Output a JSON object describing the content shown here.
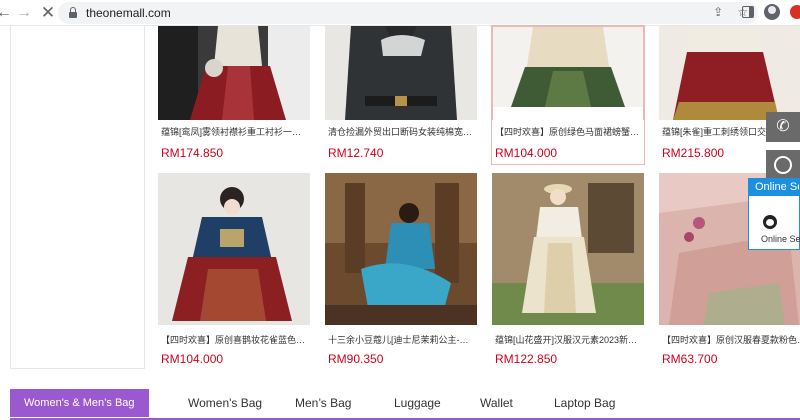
{
  "browser": {
    "url": "theonemall.com"
  },
  "products": [
    {
      "title": "蕴锦[鸾凤]雾领衬襟衫重工衬衫一片式...",
      "price": "RM174.850"
    },
    {
      "title": "清仓捡漏外贸出口断码女装纯棉宽松印...",
      "price": "RM12.740"
    },
    {
      "title": "【四时欢喜】原创绿色马面裙螃蟹黄色...",
      "price": "RM104.000"
    },
    {
      "title": "蕴锦[朱雀]重工刺绣领口交领一片...",
      "price": "RM215.800"
    },
    {
      "title": "【四时欢喜】原创喜鹊妆花雀蓝色明制...",
      "price": "RM104.000"
    },
    {
      "title": "十三余小豆蔻儿[迪士尼茉莉公主-茉莉...",
      "price": "RM90.350"
    },
    {
      "title": "蕴锦[山花盛开]汉服汉元素2023新款一...",
      "price": "RM122.850"
    },
    {
      "title": "【四时欢喜】原创汉服春夏款粉色裹...",
      "price": "RM63.700"
    }
  ],
  "online_service": {
    "header": "Online Se",
    "label": "Online Ser"
  },
  "tabs": [
    {
      "label": "Women's & Men’s Bag",
      "active": true
    },
    {
      "label": "Women's Bag"
    },
    {
      "label": "Men’s Bag"
    },
    {
      "label": "Luggage"
    },
    {
      "label": "Wallet"
    },
    {
      "label": "Laptop Bag"
    }
  ],
  "colors": {
    "price": "#d0021b",
    "tab_accent": "#9b59d0",
    "online_blue": "#1b8fe0"
  }
}
